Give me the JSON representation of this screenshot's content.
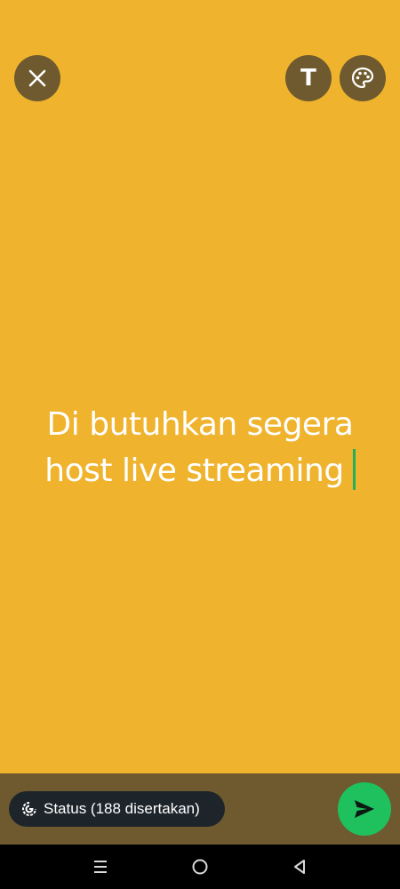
{
  "colors": {
    "background": "#efb32e",
    "overlay_button": "#6e5a2e",
    "bottom_bar": "#6e5a2e",
    "pill": "#1d252b",
    "send": "#1fc15f",
    "caret": "#1fb15a"
  },
  "toolbar": {
    "close_icon": "close-icon",
    "text_button_label": "T",
    "palette_icon": "palette-icon"
  },
  "status": {
    "text_lines": [
      "Di butuhkan segera",
      "host live streaming"
    ]
  },
  "audience": {
    "label": "Status (188 disertakan)",
    "icon": "status-icon"
  },
  "send": {
    "icon": "send-icon"
  },
  "navigation": {
    "recents_icon": "recents-icon",
    "home_icon": "home-icon",
    "back_icon": "back-icon"
  }
}
